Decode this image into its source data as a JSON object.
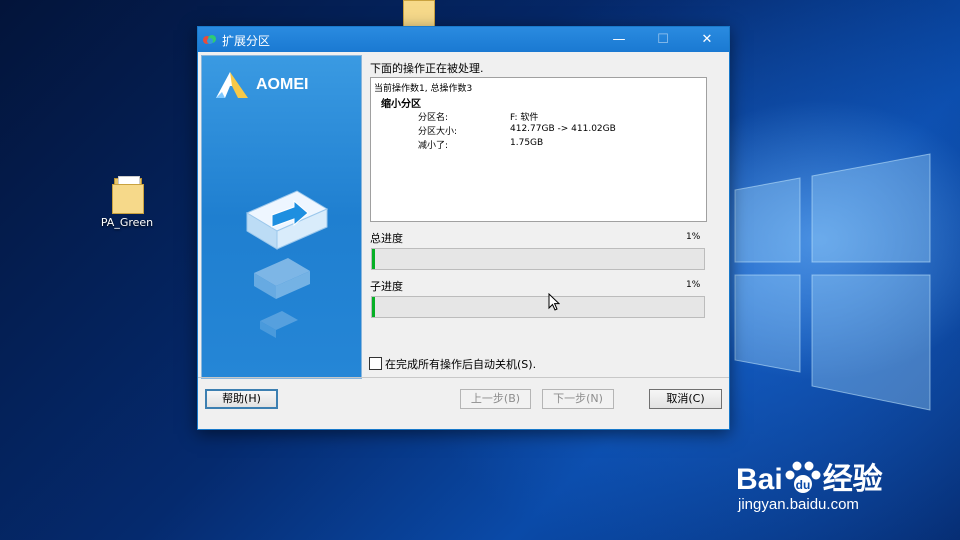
{
  "desktop": {
    "icons": [
      {
        "label": "PA_Green"
      }
    ],
    "watermark": {
      "brand": "Bai",
      "brand2": "经验",
      "url": "jingyan.baidu.com"
    }
  },
  "dialog": {
    "title": "扩展分区",
    "sidebar": {
      "brand": "AOMEI"
    },
    "status_label": "下面的操作正在被处理.",
    "ops": {
      "header": "当前操作数1, 总操作数3",
      "operation": "缩小分区",
      "rows": [
        {
          "key": "分区名:",
          "value": "F: 软件"
        },
        {
          "key": "分区大小:",
          "value": "412.77GB -> 411.02GB"
        },
        {
          "key": "减小了:",
          "value": "1.75GB"
        }
      ]
    },
    "total_progress": {
      "label": "总进度",
      "percent_text": "1%",
      "value": 0.01
    },
    "sub_progress": {
      "label": "子进度",
      "percent_text": "1%",
      "value": 0.01
    },
    "auto_shutdown": {
      "label": "在完成所有操作后自动关机(S).",
      "checked": false
    },
    "buttons": {
      "help": "帮助(H)",
      "prev": "上一步(B)",
      "next": "下一步(N)",
      "cancel": "取消(C)"
    }
  },
  "colors": {
    "titlebar": "#1a79d2",
    "progress_fill": "#06b025",
    "sidebar": "#1f7fd0"
  }
}
